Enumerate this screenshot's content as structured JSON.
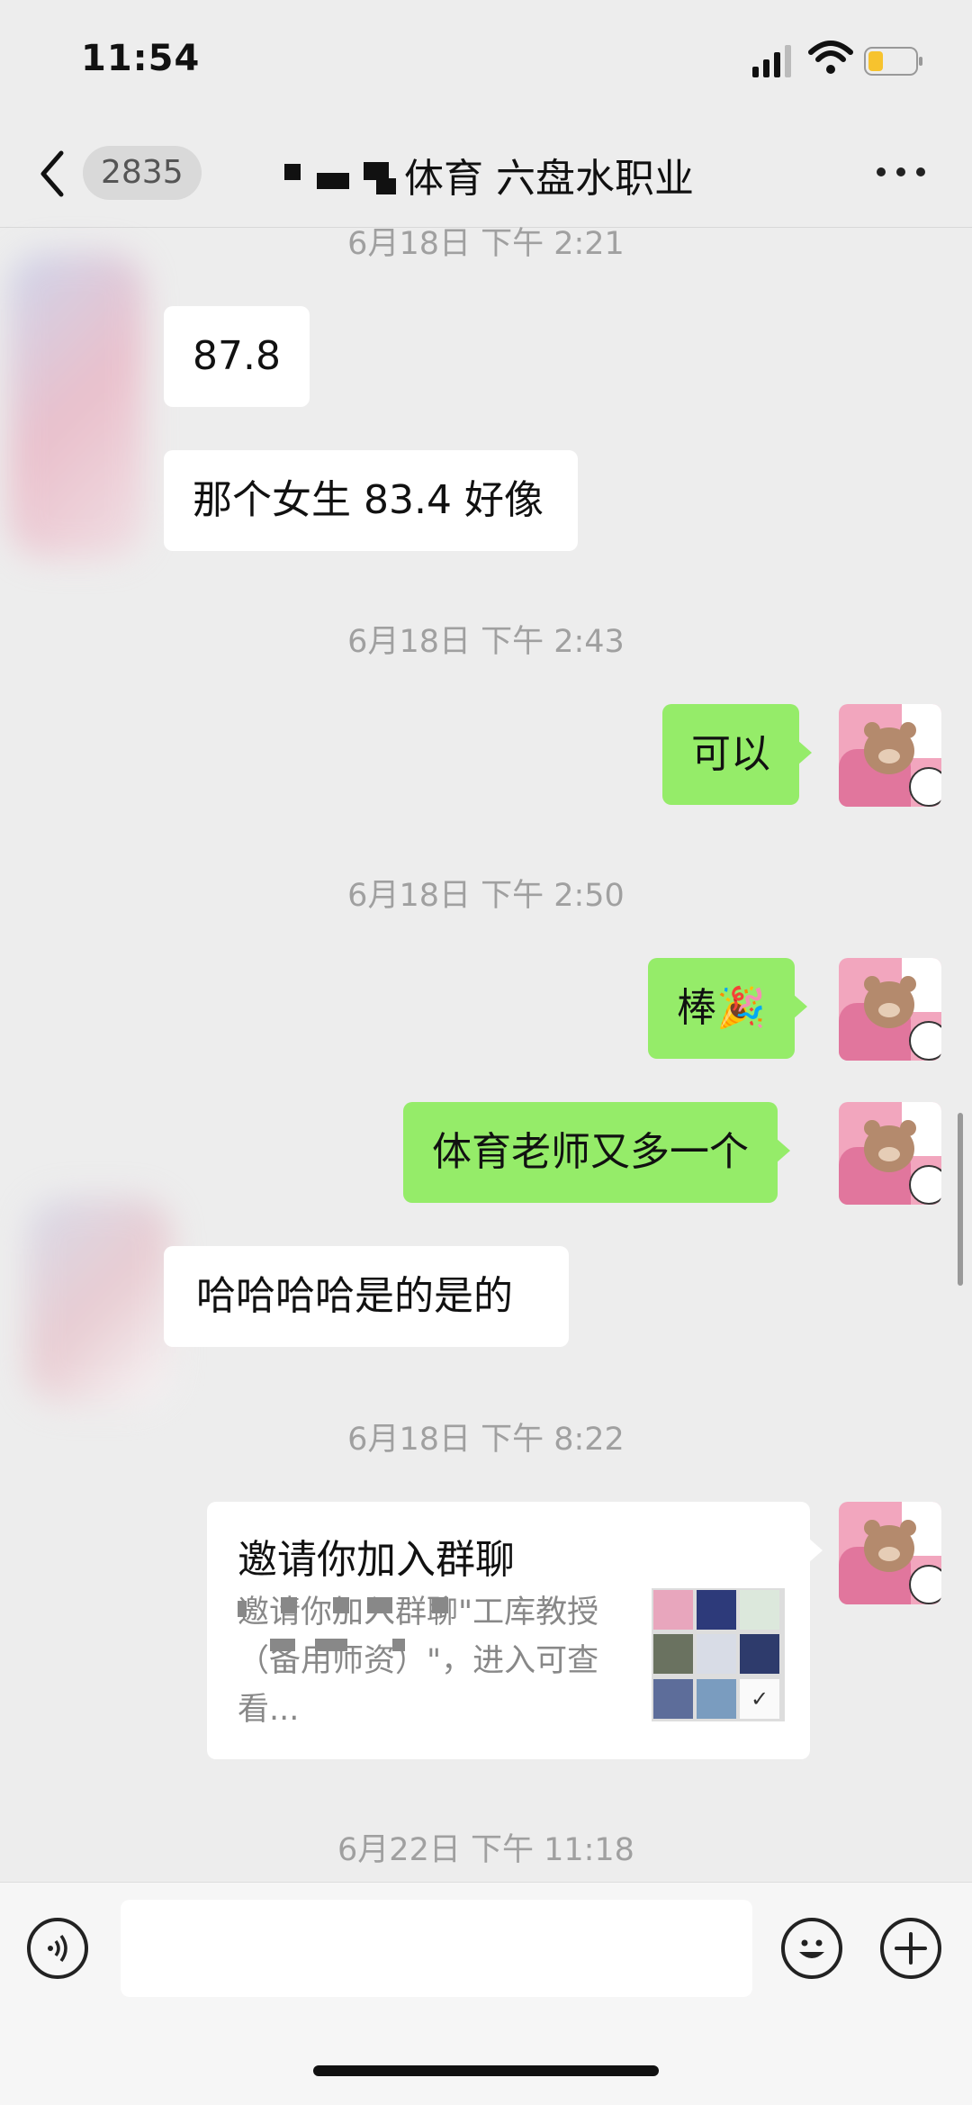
{
  "status_bar": {
    "time": "11:54"
  },
  "header": {
    "unread_count": "2835",
    "title": "体育 六盘水职业"
  },
  "messages": [
    {
      "kind": "timestamp",
      "text": "6月18日 下午 2:21"
    },
    {
      "kind": "incoming",
      "text": "87.8"
    },
    {
      "kind": "incoming",
      "text": "那个女生 83.4 好像"
    },
    {
      "kind": "timestamp",
      "text": "6月18日 下午 2:43"
    },
    {
      "kind": "outgoing",
      "text": "可以"
    },
    {
      "kind": "timestamp",
      "text": "6月18日 下午 2:50"
    },
    {
      "kind": "outgoing",
      "text": "棒🎉"
    },
    {
      "kind": "outgoing",
      "text": "体育老师又多一个"
    },
    {
      "kind": "incoming",
      "text": "哈哈哈哈是的是的"
    },
    {
      "kind": "timestamp",
      "text": "6月18日 下午 8:22"
    },
    {
      "kind": "timestamp",
      "text": "6月22日 下午 11:18"
    }
  ],
  "invite_card": {
    "title": "邀请你加入群聊",
    "description": "邀请你加入群聊\"工库教授（备用师资）\"，进入可查看..."
  },
  "icons": {
    "back": "chevron-left-icon",
    "more": "more-dots-icon",
    "voice": "voice-icon",
    "emoji": "emoji-icon",
    "plus": "plus-icon"
  },
  "colors": {
    "outgoing_bubble": "#95ec69",
    "incoming_bubble": "#ffffff",
    "background": "#ededed"
  }
}
